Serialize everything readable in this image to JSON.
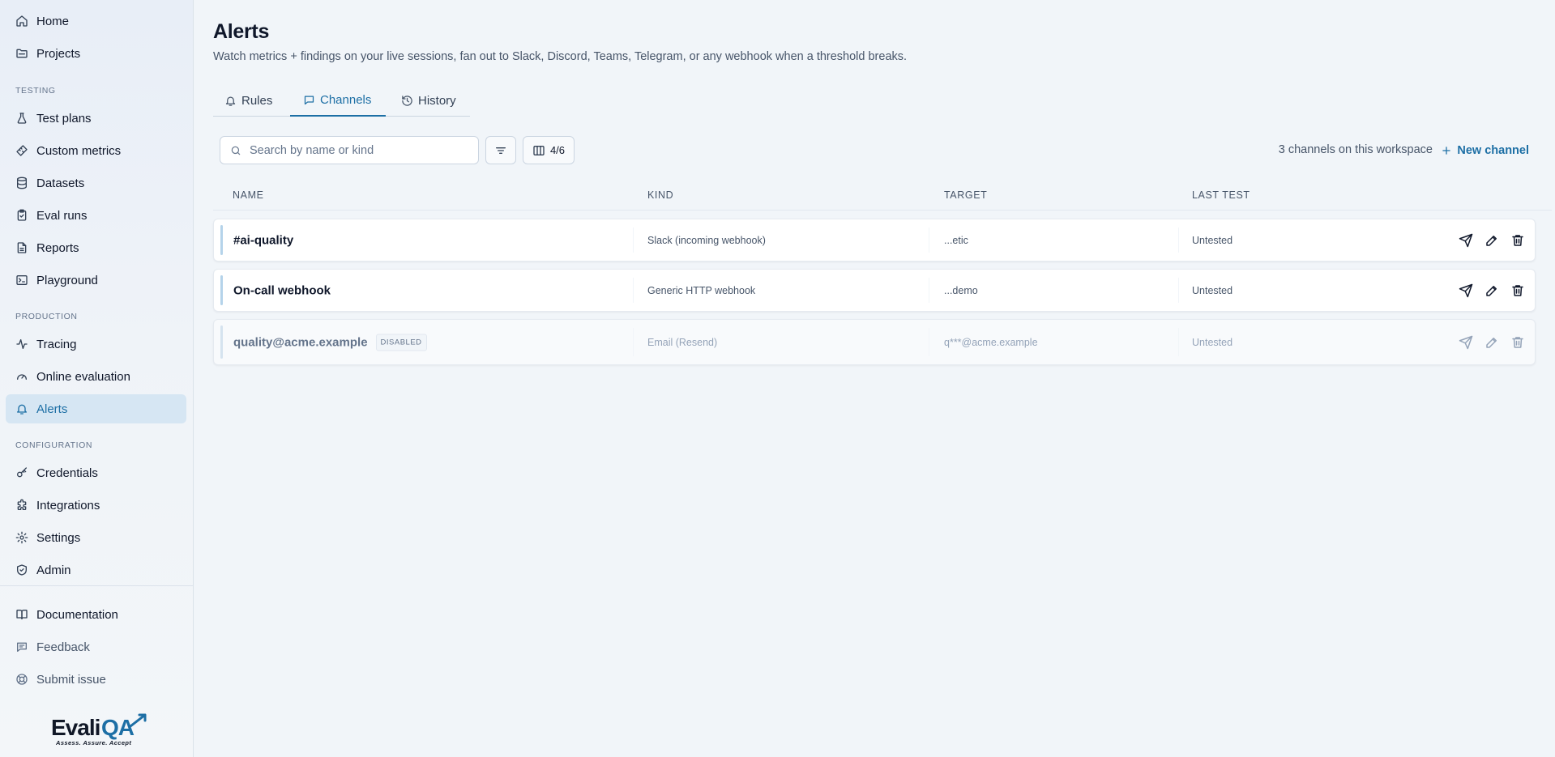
{
  "sidebar": {
    "items_top": [
      {
        "label": "Home",
        "icon": "home-icon"
      },
      {
        "label": "Projects",
        "icon": "folder-icon"
      }
    ],
    "testing_label": "TESTING",
    "testing_items": [
      {
        "label": "Test plans",
        "icon": "flask-icon"
      },
      {
        "label": "Custom metrics",
        "icon": "ruler-icon"
      },
      {
        "label": "Datasets",
        "icon": "database-icon"
      },
      {
        "label": "Eval runs",
        "icon": "clipboard-check-icon"
      },
      {
        "label": "Reports",
        "icon": "file-text-icon"
      },
      {
        "label": "Playground",
        "icon": "terminal-icon"
      }
    ],
    "production_label": "PRODUCTION",
    "production_items": [
      {
        "label": "Tracing",
        "icon": "activity-icon"
      },
      {
        "label": "Online evaluation",
        "icon": "gauge-icon"
      },
      {
        "label": "Alerts",
        "icon": "bell-icon",
        "active": true
      }
    ],
    "configuration_label": "CONFIGURATION",
    "configuration_items": [
      {
        "label": "Credentials",
        "icon": "key-icon"
      },
      {
        "label": "Integrations",
        "icon": "puzzle-icon"
      },
      {
        "label": "Settings",
        "icon": "gear-icon"
      },
      {
        "label": "Admin",
        "icon": "shield-icon"
      }
    ],
    "footer_items": [
      {
        "label": "Documentation",
        "icon": "book-icon"
      },
      {
        "label": "Feedback",
        "icon": "message-icon"
      },
      {
        "label": "Submit issue",
        "icon": "lifebuoy-icon"
      }
    ],
    "logo": {
      "text": "EvaliQA",
      "tagline": "Assess. Assure. Accept"
    }
  },
  "page": {
    "title": "Alerts",
    "subtitle": "Watch metrics + findings on your live sessions, fan out to Slack, Discord, Teams, Telegram, or any webhook when a threshold breaks."
  },
  "tabs": [
    {
      "label": "Rules",
      "icon": "bell-icon"
    },
    {
      "label": "Channels",
      "icon": "message-square-icon",
      "active": true
    },
    {
      "label": "History",
      "icon": "history-icon"
    }
  ],
  "toolbar": {
    "search_placeholder": "Search by name or kind",
    "search_value": "",
    "columns_count": "4/6",
    "count_text": "3 channels on this workspace",
    "new_channel_label": "New channel"
  },
  "table": {
    "headers": [
      "NAME",
      "KIND",
      "TARGET",
      "LAST TEST"
    ],
    "rows": [
      {
        "name": "#ai-quality",
        "kind": "Slack (incoming webhook)",
        "target": "...etic",
        "last_test": "Untested",
        "disabled": false
      },
      {
        "name": "On-call webhook",
        "kind": "Generic HTTP webhook",
        "target": "...demo",
        "last_test": "Untested",
        "disabled": false
      },
      {
        "name": "quality@acme.example",
        "badge": "DISABLED",
        "kind": "Email (Resend)",
        "target": "q***@acme.example",
        "last_test": "Untested",
        "disabled": true
      }
    ]
  },
  "colors": {
    "accent": "#1d6fa5",
    "active_nav_bg": "#d6e6f3",
    "page_bg": "#f1f5f9"
  }
}
